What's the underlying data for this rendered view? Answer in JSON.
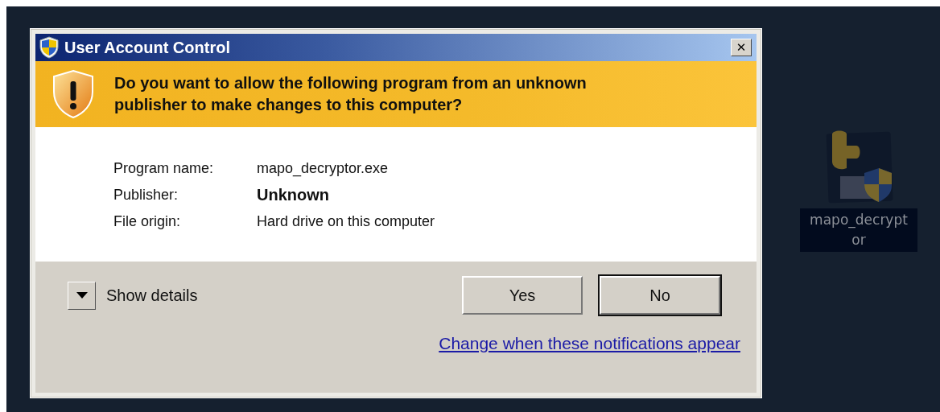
{
  "window": {
    "title": "User Account Control",
    "close": "✕"
  },
  "question": [
    "Do you want to allow the following program from an unknown",
    "publisher to make changes to this computer?"
  ],
  "details": [
    {
      "label": "Program name:",
      "value": "mapo_decryptor.exe",
      "emphasis": false
    },
    {
      "label": "Publisher:",
      "value": "Unknown",
      "emphasis": true
    },
    {
      "label": "File origin:",
      "value": "Hard drive on this computer",
      "emphasis": false
    }
  ],
  "show_details": {
    "label": "Show details",
    "expanded": false
  },
  "buttons": [
    {
      "label": "Yes",
      "default": false
    },
    {
      "label": "No",
      "default": true
    }
  ],
  "link": "Change when these notifications appear",
  "desktop_icon": {
    "label": "mapo_decryptor",
    "selected": true
  }
}
